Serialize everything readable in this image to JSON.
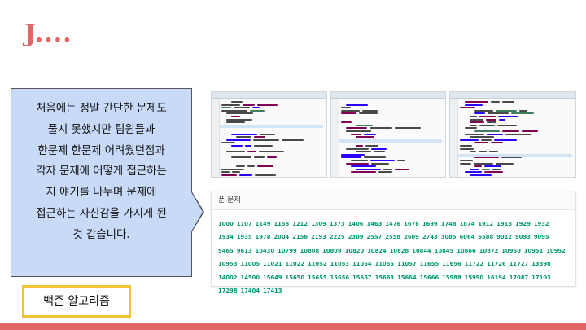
{
  "slide": {
    "title": "J...."
  },
  "callout": {
    "lines": [
      "처음에는 정말 간단한 문제도",
      "풀지 못했지만 팀원들과",
      "한문제 한문제 어려웠던점과",
      "각자 문제에 어떻게 접근하는",
      "지 얘기를 나누며 문제에",
      "접근하는 자신감을 가지게 된",
      "것 같습니다."
    ]
  },
  "tag": {
    "label": "백준 알고리즘"
  },
  "solved": {
    "header": "푼 문제",
    "problems": [
      "1000",
      "1107",
      "1149",
      "1158",
      "1212",
      "1309",
      "1373",
      "1406",
      "1463",
      "1476",
      "1676",
      "1699",
      "1748",
      "1874",
      "1912",
      "1918",
      "1929",
      "1932",
      "1934",
      "1935",
      "1978",
      "2004",
      "2156",
      "2193",
      "2225",
      "2309",
      "2557",
      "2558",
      "2609",
      "2743",
      "3085",
      "6064",
      "6588",
      "9012",
      "9093",
      "9095",
      "9465",
      "9613",
      "10430",
      "10799",
      "10808",
      "10809",
      "10820",
      "10824",
      "10828",
      "10844",
      "10845",
      "10866",
      "10872",
      "10950",
      "10951",
      "10952",
      "10953",
      "11005",
      "11021",
      "11022",
      "11052",
      "11053",
      "11054",
      "11055",
      "11057",
      "11655",
      "11656",
      "11722",
      "11726",
      "11727",
      "13398",
      "14002",
      "14500",
      "15649",
      "15650",
      "15655",
      "15656",
      "15657",
      "15663",
      "15664",
      "15666",
      "15988",
      "15990",
      "16194",
      "17087",
      "17103",
      "17298",
      "17404",
      "17413"
    ]
  },
  "colors": {
    "accent": "#e06666",
    "callout_bg": "#c9daf8",
    "tag_border": "#f1c232",
    "problem_link": "#009874"
  },
  "screenshots": {
    "count": 3,
    "content": "code-editor"
  }
}
